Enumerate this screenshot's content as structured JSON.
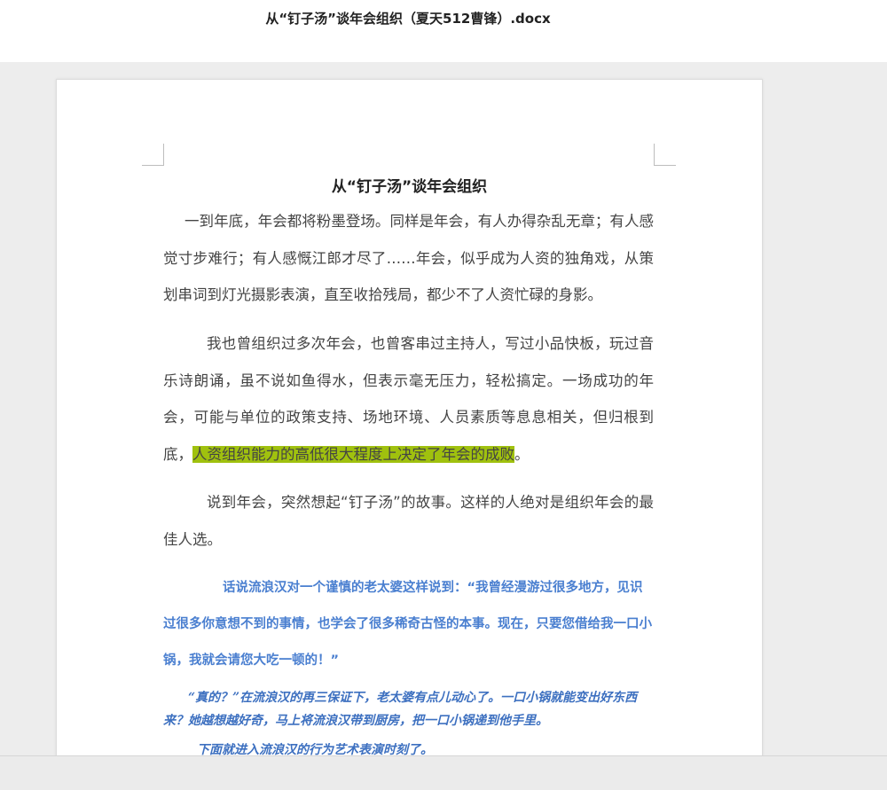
{
  "window": {
    "file_title": "从“钉子汤”谈年会组织（夏天512曹锋）.docx"
  },
  "document": {
    "heading": "从“钉子汤”谈年会组织",
    "p1": "一到年底，年会都将粉墨登场。同样是年会，有人办得杂乱无章；有人感觉寸步难行；有人感慨江郎才尽了……年会，似乎成为人资的独角戏，从策划串词到灯光摄影表演，直至收拾残局，都少不了人资忙碌的身影。",
    "p2_before": "我也曾组织过多次年会，也曾客串过主持人，写过小品快板，玩过音乐诗朗诵，虽不说如鱼得水，但表示毫无压力，轻松搞定。一场成功的年会，可能与单位的政策支持、场地环境、人员素质等息息相关，但归根到底，",
    "p2_highlight": "人资组织能力的高低很大程度上决定了年会的成败",
    "p2_after": "。",
    "p3": "说到年会，突然想起“钉子汤”的故事。这样的人绝对是组织年会的最佳人选。",
    "q1": "话说流浪汉对一个谨慎的老太婆这样说到：“我曾经漫游过很多地方，见识过很多你意想不到的事情，也学会了很多稀奇古怪的本事。现在，只要您借给我一口小锅，我就会请您大吃一顿的！”",
    "q2": "“真的？”在流浪汉的再三保证下，老太婆有点儿动心了。一口小锅就能变出好东西来？她越想越好奇，马上将流浪汉带到厨房，把一口小锅递到他手里。",
    "q3": "下面就进入流浪汉的行为艺术表演时刻了。"
  },
  "colors": {
    "highlight": "#a0c10e",
    "quote_text": "#4a7fd0"
  }
}
